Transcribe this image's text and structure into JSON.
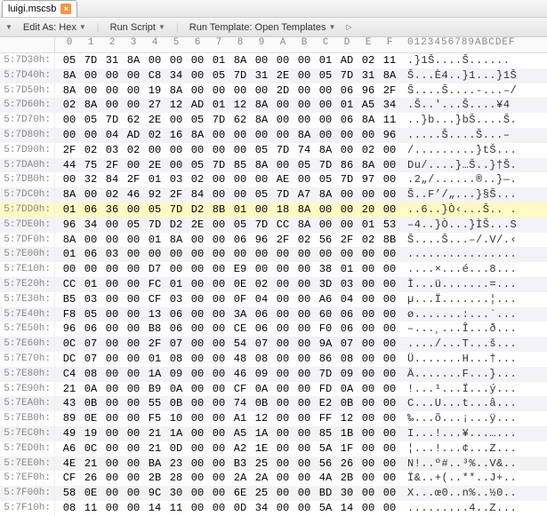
{
  "tab": {
    "filename": "luigi.mscsb"
  },
  "toolbar": {
    "edit_as": "Edit As: Hex",
    "run_script": "Run Script",
    "run_template": "Run Template: Open Templates"
  },
  "columns": {
    "hex": [
      "0",
      "1",
      "2",
      "3",
      "4",
      "5",
      "6",
      "7",
      "8",
      "9",
      "A",
      "B",
      "C",
      "D",
      "E",
      "F"
    ],
    "ascii": "0123456789ABCDEF"
  },
  "highlight_index": 10,
  "rows": [
    {
      "addr": "5:7D30h:",
      "hex": [
        "05",
        "7D",
        "31",
        "8A",
        "00",
        "00",
        "00",
        "01",
        "8A",
        "00",
        "00",
        "00",
        "01",
        "AD",
        "02",
        "11"
      ],
      "asc": ".}1Š....Š....­.."
    },
    {
      "addr": "5:7D40h:",
      "hex": [
        "8A",
        "00",
        "00",
        "00",
        "C8",
        "34",
        "00",
        "05",
        "7D",
        "31",
        "2E",
        "00",
        "05",
        "7D",
        "31",
        "8A"
      ],
      "asc": "Š...È4..}1...}1Š"
    },
    {
      "addr": "5:7D50h:",
      "hex": [
        "8A",
        "00",
        "00",
        "00",
        "19",
        "8A",
        "00",
        "00",
        "00",
        "00",
        "2D",
        "00",
        "00",
        "06",
        "96",
        "2F"
      ],
      "asc": "Š....Š....-...–/"
    },
    {
      "addr": "5:7D60h:",
      "hex": [
        "02",
        "8A",
        "00",
        "00",
        "27",
        "12",
        "AD",
        "01",
        "12",
        "8A",
        "00",
        "00",
        "00",
        "01",
        "A5",
        "34"
      ],
      "asc": ".Š..'.­..Š....¥4"
    },
    {
      "addr": "5:7D70h:",
      "hex": [
        "00",
        "05",
        "7D",
        "62",
        "2E",
        "00",
        "05",
        "7D",
        "62",
        "8A",
        "00",
        "00",
        "00",
        "06",
        "8A",
        "11"
      ],
      "asc": "..}b...}bŠ....Š."
    },
    {
      "addr": "5:7D80h:",
      "hex": [
        "00",
        "00",
        "04",
        "AD",
        "02",
        "16",
        "8A",
        "00",
        "00",
        "00",
        "00",
        "8A",
        "00",
        "00",
        "00",
        "96"
      ],
      "asc": "...­..Š....Š...–"
    },
    {
      "addr": "5:7D90h:",
      "hex": [
        "2F",
        "02",
        "03",
        "02",
        "00",
        "00",
        "00",
        "00",
        "00",
        "05",
        "7D",
        "74",
        "8A",
        "00",
        "02",
        "00"
      ],
      "asc": "/.........}tŠ..."
    },
    {
      "addr": "5:7DA0h:",
      "hex": [
        "44",
        "75",
        "2F",
        "00",
        "2E",
        "00",
        "05",
        "7D",
        "85",
        "8A",
        "00",
        "05",
        "7D",
        "86",
        "8A",
        "00"
      ],
      "asc": "Du/....}…Š..}†Š."
    },
    {
      "addr": "5:7DB0h:",
      "hex": [
        "00",
        "32",
        "84",
        "2F",
        "01",
        "03",
        "02",
        "00",
        "00",
        "00",
        "AE",
        "00",
        "05",
        "7D",
        "97",
        "00"
      ],
      "asc": ".2„/......®..}—."
    },
    {
      "addr": "5:7DC0h:",
      "hex": [
        "8A",
        "00",
        "02",
        "46",
        "92",
        "2F",
        "84",
        "00",
        "00",
        "05",
        "7D",
        "A7",
        "8A",
        "00",
        "00",
        "00"
      ],
      "asc": "Š..F’/„...}§Š..."
    },
    {
      "addr": "5:7DD0h:",
      "hex": [
        "01",
        "06",
        "36",
        "00",
        "05",
        "7D",
        "D2",
        "8B",
        "01",
        "00",
        "18",
        "8A",
        "00",
        "00",
        "20",
        "00"
      ],
      "asc": "..6..}Ò‹...Š.. ."
    },
    {
      "addr": "5:7DE0h:",
      "hex": [
        "96",
        "34",
        "00",
        "05",
        "7D",
        "D2",
        "2E",
        "00",
        "05",
        "7D",
        "CC",
        "8A",
        "00",
        "00",
        "01",
        "53"
      ],
      "asc": "–4..}Ò...}ÌŠ...S"
    },
    {
      "addr": "5:7DF0h:",
      "hex": [
        "8A",
        "00",
        "00",
        "00",
        "01",
        "8A",
        "00",
        "00",
        "06",
        "96",
        "2F",
        "02",
        "56",
        "2F",
        "02",
        "8B"
      ],
      "asc": "Š....Š...–/.V/.‹"
    },
    {
      "addr": "5:7E00h:",
      "hex": [
        "01",
        "06",
        "03",
        "00",
        "00",
        "00",
        "00",
        "00",
        "00",
        "00",
        "00",
        "00",
        "00",
        "00",
        "00",
        "00"
      ],
      "asc": "................"
    },
    {
      "addr": "5:7E10h:",
      "hex": [
        "00",
        "00",
        "00",
        "00",
        "D7",
        "00",
        "00",
        "00",
        "E9",
        "00",
        "00",
        "00",
        "38",
        "01",
        "00",
        "00"
      ],
      "asc": "....×...é...8..."
    },
    {
      "addr": "5:7E20h:",
      "hex": [
        "CC",
        "01",
        "00",
        "00",
        "FC",
        "01",
        "00",
        "00",
        "0E",
        "02",
        "00",
        "00",
        "3D",
        "03",
        "00",
        "00"
      ],
      "asc": "Ì...ü.......=..."
    },
    {
      "addr": "5:7E30h:",
      "hex": [
        "B5",
        "03",
        "00",
        "00",
        "CF",
        "03",
        "00",
        "00",
        "0F",
        "04",
        "00",
        "00",
        "A6",
        "04",
        "00",
        "00"
      ],
      "asc": "µ...Ï.......¦..."
    },
    {
      "addr": "5:7E40h:",
      "hex": [
        "F8",
        "05",
        "00",
        "00",
        "13",
        "06",
        "00",
        "00",
        "3A",
        "06",
        "00",
        "00",
        "60",
        "06",
        "00",
        "00"
      ],
      "asc": "ø.......:...`..."
    },
    {
      "addr": "5:7E50h:",
      "hex": [
        "96",
        "06",
        "00",
        "00",
        "B8",
        "06",
        "00",
        "00",
        "CE",
        "06",
        "00",
        "00",
        "F0",
        "06",
        "00",
        "00"
      ],
      "asc": "–...¸...Î...ð..."
    },
    {
      "addr": "5:7E60h:",
      "hex": [
        "0C",
        "07",
        "00",
        "00",
        "2F",
        "07",
        "00",
        "00",
        "54",
        "07",
        "00",
        "00",
        "9A",
        "07",
        "00",
        "00"
      ],
      "asc": "..../...T...š..."
    },
    {
      "addr": "5:7E70h:",
      "hex": [
        "DC",
        "07",
        "00",
        "00",
        "01",
        "08",
        "00",
        "00",
        "48",
        "08",
        "00",
        "00",
        "86",
        "08",
        "00",
        "00"
      ],
      "asc": "Ü.......H...†..."
    },
    {
      "addr": "5:7E80h:",
      "hex": [
        "C4",
        "08",
        "00",
        "00",
        "1A",
        "09",
        "00",
        "00",
        "46",
        "09",
        "00",
        "00",
        "7D",
        "09",
        "00",
        "00"
      ],
      "asc": "Ä.......F...}..."
    },
    {
      "addr": "5:7E90h:",
      "hex": [
        "21",
        "0A",
        "00",
        "00",
        "B9",
        "0A",
        "00",
        "00",
        "CF",
        "0A",
        "00",
        "00",
        "FD",
        "0A",
        "00",
        "00"
      ],
      "asc": "!...¹...Ï...ý..."
    },
    {
      "addr": "5:7EA0h:",
      "hex": [
        "43",
        "0B",
        "00",
        "00",
        "55",
        "0B",
        "00",
        "00",
        "74",
        "0B",
        "00",
        "00",
        "E2",
        "0B",
        "00",
        "00"
      ],
      "asc": "C...U...t...â..."
    },
    {
      "addr": "5:7EB0h:",
      "hex": [
        "89",
        "0E",
        "00",
        "00",
        "F5",
        "10",
        "00",
        "00",
        "A1",
        "12",
        "00",
        "00",
        "FF",
        "12",
        "00",
        "00"
      ],
      "asc": "‰...õ...¡...ÿ..."
    },
    {
      "addr": "5:7EC0h:",
      "hex": [
        "49",
        "19",
        "00",
        "00",
        "21",
        "1A",
        "00",
        "00",
        "A5",
        "1A",
        "00",
        "00",
        "85",
        "1B",
        "00",
        "00"
      ],
      "asc": "I...!...¥...…..."
    },
    {
      "addr": "5:7ED0h:",
      "hex": [
        "A6",
        "0C",
        "00",
        "00",
        "21",
        "0D",
        "00",
        "00",
        "A2",
        "1E",
        "00",
        "00",
        "5A",
        "1F",
        "00",
        "00"
      ],
      "asc": "¦...!...¢...Z..."
    },
    {
      "addr": "5:7EE0h:",
      "hex": [
        "4E",
        "21",
        "00",
        "00",
        "BA",
        "23",
        "00",
        "00",
        "B3",
        "25",
        "00",
        "00",
        "56",
        "26",
        "00",
        "00"
      ],
      "asc": "N!..º#..³%..V&.."
    },
    {
      "addr": "5:7EF0h:",
      "hex": [
        "CF",
        "26",
        "00",
        "00",
        "2B",
        "28",
        "00",
        "00",
        "2A",
        "2A",
        "00",
        "00",
        "4A",
        "2B",
        "00",
        "00"
      ],
      "asc": "Ï&..+(..**..J+.."
    },
    {
      "addr": "5:7F00h:",
      "hex": [
        "58",
        "0E",
        "00",
        "00",
        "9C",
        "30",
        "00",
        "00",
        "6E",
        "25",
        "00",
        "00",
        "BD",
        "30",
        "00",
        "00"
      ],
      "asc": "X...œ0..n%..½0.."
    },
    {
      "addr": "5:7F10h:",
      "hex": [
        "08",
        "11",
        "00",
        "00",
        "14",
        "11",
        "00",
        "00",
        "0D",
        "34",
        "00",
        "00",
        "5A",
        "14",
        "00",
        "00"
      ],
      "asc": ".........4..Z..."
    }
  ]
}
